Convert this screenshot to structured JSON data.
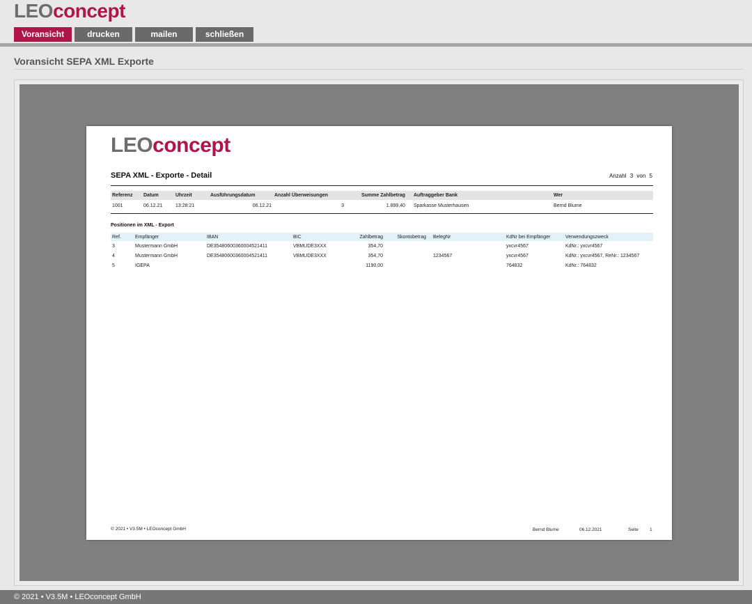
{
  "brand": {
    "leo": "LEO",
    "concept": "concept",
    "accent_color": "#b0154a",
    "gray_color": "#6d6d6d"
  },
  "nav": [
    {
      "label": "Voransicht",
      "active": true
    },
    {
      "label": "drucken",
      "active": false
    },
    {
      "label": "mailen",
      "active": false
    },
    {
      "label": "schließen",
      "active": false
    }
  ],
  "page_title": "Voransicht SEPA XML Exporte",
  "document": {
    "title": "SEPA XML - Exporte - Detail",
    "count_label": "Anzahl",
    "count_current": "3",
    "count_sep": "von",
    "count_total": "5",
    "summary": {
      "headers": [
        "Referenz",
        "Datum",
        "Uhrzeit",
        "Ausführungsdatum",
        "Anzahl Überweisungen",
        "Summe Zahlbetrag",
        "Auftraggeber Bank",
        "Wer"
      ],
      "row": [
        "1001",
        "06.12.21",
        "13:28:21",
        "06.12.21",
        "3",
        "1.899,40",
        "Sparkasse Musterhausen",
        "Bernd Blume"
      ]
    },
    "positions_heading": "Positionen im XML - Export",
    "positions": {
      "headers": [
        "Ref.",
        "Empfänger",
        "IBAN",
        "BIC",
        "Zahlbetrag",
        "Skontobetrag",
        "BelegNr",
        "KdNr bei Empfänger",
        "Verwendungszweck"
      ],
      "rows": [
        [
          "3",
          "Mustermann GmbH",
          "DE35480600360004521411",
          "VBMUDE3XXX",
          "354,70",
          "",
          "",
          "yxcvr4567",
          "KdNr.: yxcvr4567"
        ],
        [
          "4",
          "Mustermann GmbH",
          "DE35480600360004521411",
          "VBMUDE3XXX",
          "354,70",
          "",
          "1234567",
          "yxcvr4567",
          "KdNr.: yxcvr4567, ReNr.: 1234567"
        ],
        [
          "5",
          "IGEPA",
          "",
          "",
          "1190,00",
          "",
          "",
          "764832",
          "KdNr.: 764832"
        ]
      ]
    },
    "footer": {
      "left": "© 2021 • V3.5M • LEOconcept GmbH",
      "user": "Bernd Blume",
      "date": "06.12.2021",
      "page_label": "Seite",
      "page_number": "1"
    }
  },
  "status_text": "© 2021 • V3.5M • LEOconcept GmbH"
}
